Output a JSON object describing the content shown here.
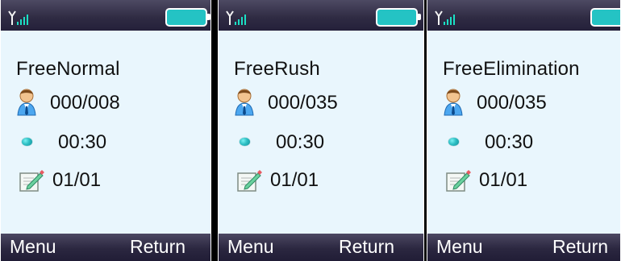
{
  "icons": {
    "signal": "signal-strength-icon",
    "battery": "battery-icon",
    "player": "user-icon",
    "timer": "dot-icon",
    "round": "edit-icon"
  },
  "colors": {
    "screen_background": "#e9f6fd",
    "status_bar": "#2f2b43",
    "softkey_bar": "#2b2740",
    "battery_fill": "#24c3c4",
    "text": "#111111",
    "softkey_text": "#ffffff"
  },
  "screens": [
    {
      "mode_title": "FreeNormal",
      "players": "000/008",
      "time": "00:30",
      "round": "01/01",
      "softkeys": {
        "left": "Menu",
        "right": "Return"
      }
    },
    {
      "mode_title": "FreeRush",
      "players": "000/035",
      "time": "00:30",
      "round": "01/01",
      "softkeys": {
        "left": "Menu",
        "right": "Return"
      }
    },
    {
      "mode_title": "FreeElimination",
      "players": "000/035",
      "time": "00:30",
      "round": "01/01",
      "softkeys": {
        "left": "Menu",
        "right": "Return"
      }
    }
  ]
}
